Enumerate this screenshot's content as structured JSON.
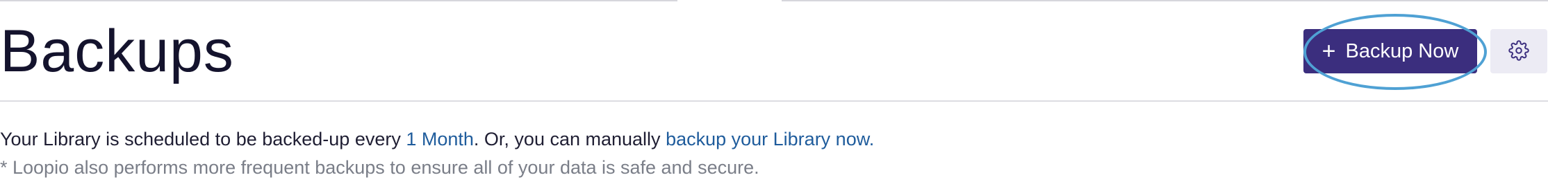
{
  "header": {
    "title": "Backups",
    "backup_button_label": "Backup Now",
    "plus_icon": "+",
    "settings_icon": "gear-icon"
  },
  "schedule": {
    "prefix": "Your Library is scheduled to be backed-up every ",
    "frequency_link": "1 Month",
    "middle": ". Or, you can manually ",
    "backup_link": "backup your Library now.",
    "note": "* Loopio also performs more frequent backups to ensure all of your data is safe and secure."
  },
  "colors": {
    "primary_button": "#3b2e7e",
    "highlight_ring": "#4fa1d4",
    "link": "#1f5c9c",
    "note_text": "#7a7e88"
  }
}
